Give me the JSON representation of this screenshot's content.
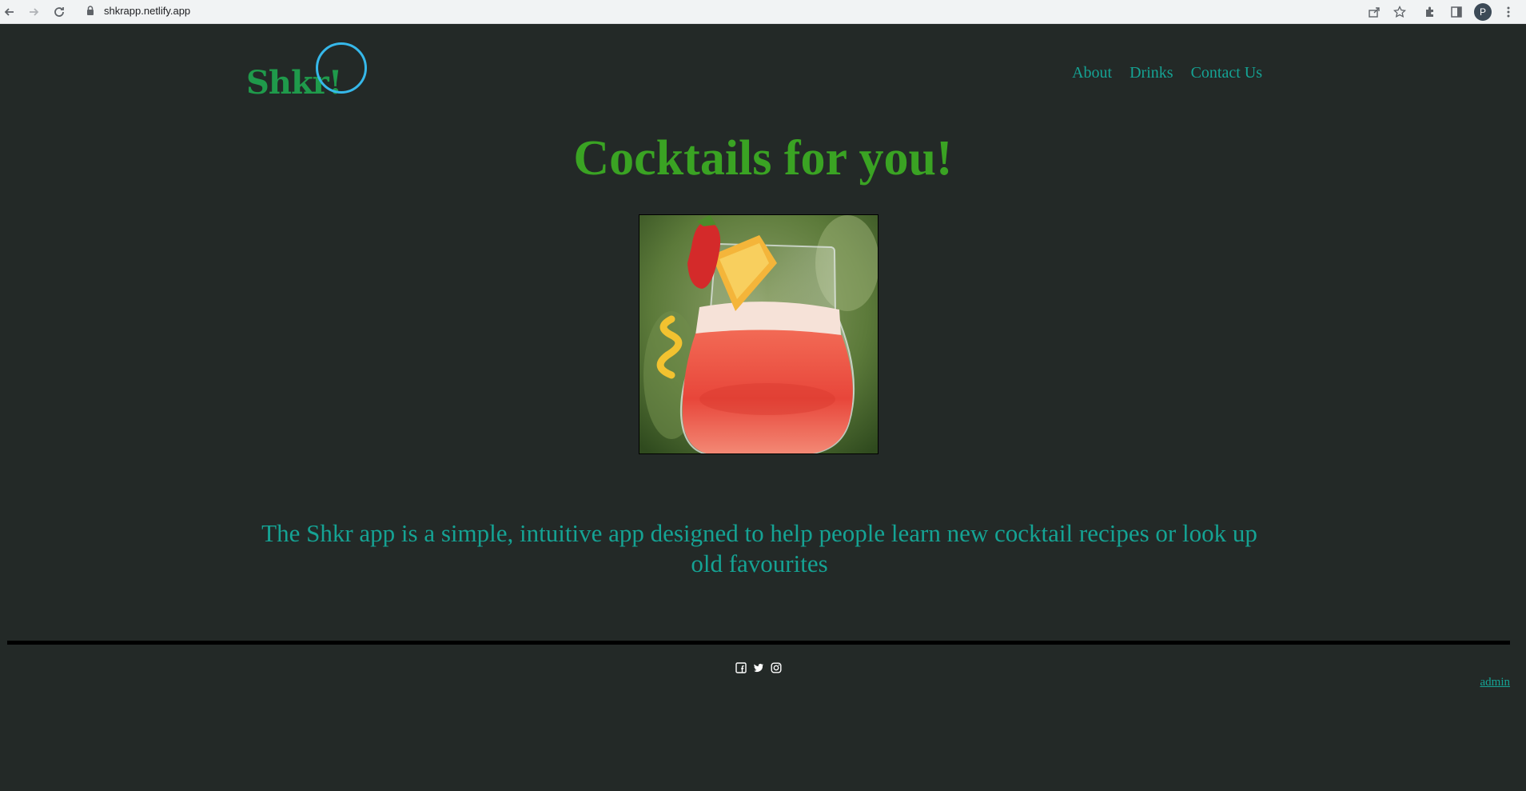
{
  "browser": {
    "url": "shkrapp.netlify.app",
    "profile_initial": "P"
  },
  "header": {
    "logo": "Shkr!",
    "nav": [
      {
        "label": "About"
      },
      {
        "label": "Drinks"
      },
      {
        "label": "Contact Us"
      }
    ]
  },
  "hero": {
    "title": "Cocktails for you!",
    "image_alt": "strawberry-cocktail"
  },
  "tagline": "The Shkr app is a simple, intuitive app designed to help people learn new cocktail recipes or look up old favourites",
  "footer": {
    "social_icons": [
      "facebook-icon",
      "twitter-icon",
      "instagram-icon"
    ],
    "admin_link": "admin"
  },
  "colors": {
    "background": "#232927",
    "logo": "#1f9a4b",
    "title": "#3aa323",
    "teal": "#15a394",
    "cursor_ring": "#36b8ea"
  }
}
